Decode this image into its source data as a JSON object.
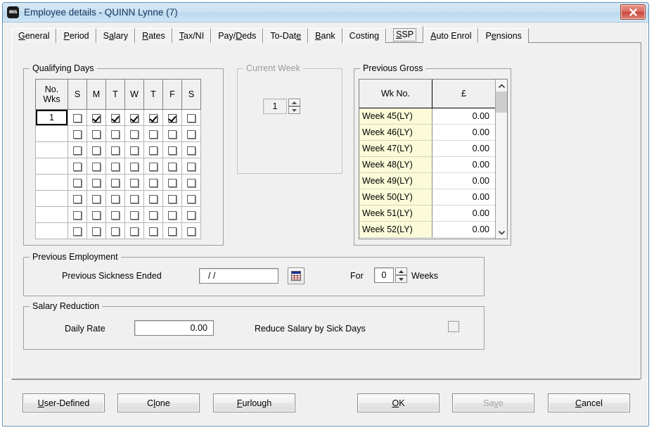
{
  "window": {
    "title": "Employee details - QUINN Lynne (7)",
    "app_icon": "app-icon",
    "close_icon": "close-icon",
    "close_label": "Close"
  },
  "tabs": [
    {
      "label": "General",
      "mnemonic": "G",
      "selected": false
    },
    {
      "label": "Period",
      "mnemonic": "P",
      "selected": false
    },
    {
      "label": "Salary",
      "mnemonic": "a",
      "selected": false
    },
    {
      "label": "Rates",
      "mnemonic": "R",
      "selected": false
    },
    {
      "label": "Tax/NI",
      "mnemonic": "T",
      "selected": false
    },
    {
      "label": "Pay/Deds",
      "mnemonic": "D",
      "selected": false
    },
    {
      "label": "To-Date",
      "mnemonic": "e",
      "selected": false
    },
    {
      "label": "Bank",
      "mnemonic": "B",
      "selected": false
    },
    {
      "label": "Costing",
      "mnemonic": "",
      "selected": false
    },
    {
      "label": "SSP",
      "mnemonic": "S",
      "selected": true
    },
    {
      "label": "Auto Enrol",
      "mnemonic": "A",
      "selected": false
    },
    {
      "label": "Pensions",
      "mnemonic": "e",
      "selected": false
    }
  ],
  "qualifying_days": {
    "group_title": "Qualifying Days",
    "wk_header_line1": "No.",
    "wk_header_line2": "Wks",
    "day_headers": [
      "S",
      "M",
      "T",
      "W",
      "T",
      "F",
      "S"
    ],
    "rows": [
      {
        "wks": "1",
        "selected": true,
        "days": [
          false,
          true,
          true,
          true,
          true,
          true,
          false
        ]
      },
      {
        "wks": "",
        "selected": false,
        "days": [
          false,
          false,
          false,
          false,
          false,
          false,
          false
        ]
      },
      {
        "wks": "",
        "selected": false,
        "days": [
          false,
          false,
          false,
          false,
          false,
          false,
          false
        ]
      },
      {
        "wks": "",
        "selected": false,
        "days": [
          false,
          false,
          false,
          false,
          false,
          false,
          false
        ]
      },
      {
        "wks": "",
        "selected": false,
        "days": [
          false,
          false,
          false,
          false,
          false,
          false,
          false
        ]
      },
      {
        "wks": "",
        "selected": false,
        "days": [
          false,
          false,
          false,
          false,
          false,
          false,
          false
        ]
      },
      {
        "wks": "",
        "selected": false,
        "days": [
          false,
          false,
          false,
          false,
          false,
          false,
          false
        ]
      },
      {
        "wks": "",
        "selected": false,
        "days": [
          false,
          false,
          false,
          false,
          false,
          false,
          false
        ]
      }
    ]
  },
  "current_week": {
    "group_title": "Current Week",
    "disabled": true,
    "value": "1",
    "spin_up_icon": "spin-up-icon",
    "spin_down_icon": "spin-down-icon"
  },
  "previous_gross": {
    "group_title": "Previous Gross",
    "col_week": "Wk No.",
    "col_amount": "£",
    "rows": [
      {
        "week": "Week 45(LY)",
        "amount": "0.00"
      },
      {
        "week": "Week 46(LY)",
        "amount": "0.00"
      },
      {
        "week": "Week 47(LY)",
        "amount": "0.00"
      },
      {
        "week": "Week 48(LY)",
        "amount": "0.00"
      },
      {
        "week": "Week 49(LY)",
        "amount": "0.00"
      },
      {
        "week": "Week 50(LY)",
        "amount": "0.00"
      },
      {
        "week": "Week 51(LY)",
        "amount": "0.00"
      },
      {
        "week": "Week 52(LY)",
        "amount": "0.00"
      }
    ],
    "scroll_up_icon": "scroll-up-icon",
    "scroll_down_icon": "scroll-down-icon"
  },
  "previous_employment": {
    "group_title": "Previous Employment",
    "sickness_label": "Previous Sickness Ended",
    "sickness_value": "/ /",
    "calendar_icon": "calendar-icon",
    "for_label": "For",
    "weeks_value": "0",
    "weeks_label": "Weeks"
  },
  "salary_reduction": {
    "group_title": "Salary Reduction",
    "daily_rate_label": "Daily Rate",
    "daily_rate_value": "0.00",
    "reduce_label": "Reduce Salary by Sick Days",
    "reduce_checked": false
  },
  "buttons": {
    "user_defined": {
      "label": "User-Defined",
      "mnemonic": "U",
      "disabled": false
    },
    "clone": {
      "label": "Clone",
      "mnemonic": "l",
      "disabled": false
    },
    "furlough": {
      "label": "Furlough",
      "mnemonic": "F",
      "disabled": false
    },
    "ok": {
      "label": "OK",
      "mnemonic": "O",
      "disabled": false
    },
    "save": {
      "label": "Save",
      "mnemonic": "v",
      "disabled": true
    },
    "cancel": {
      "label": "Cancel",
      "mnemonic": "C",
      "disabled": false
    }
  },
  "colors": {
    "title_text": "#16335c",
    "close_button": "#c8493c",
    "week_cell_bg": "#fbfbd9",
    "panel_bg": "#f0f0f0"
  }
}
